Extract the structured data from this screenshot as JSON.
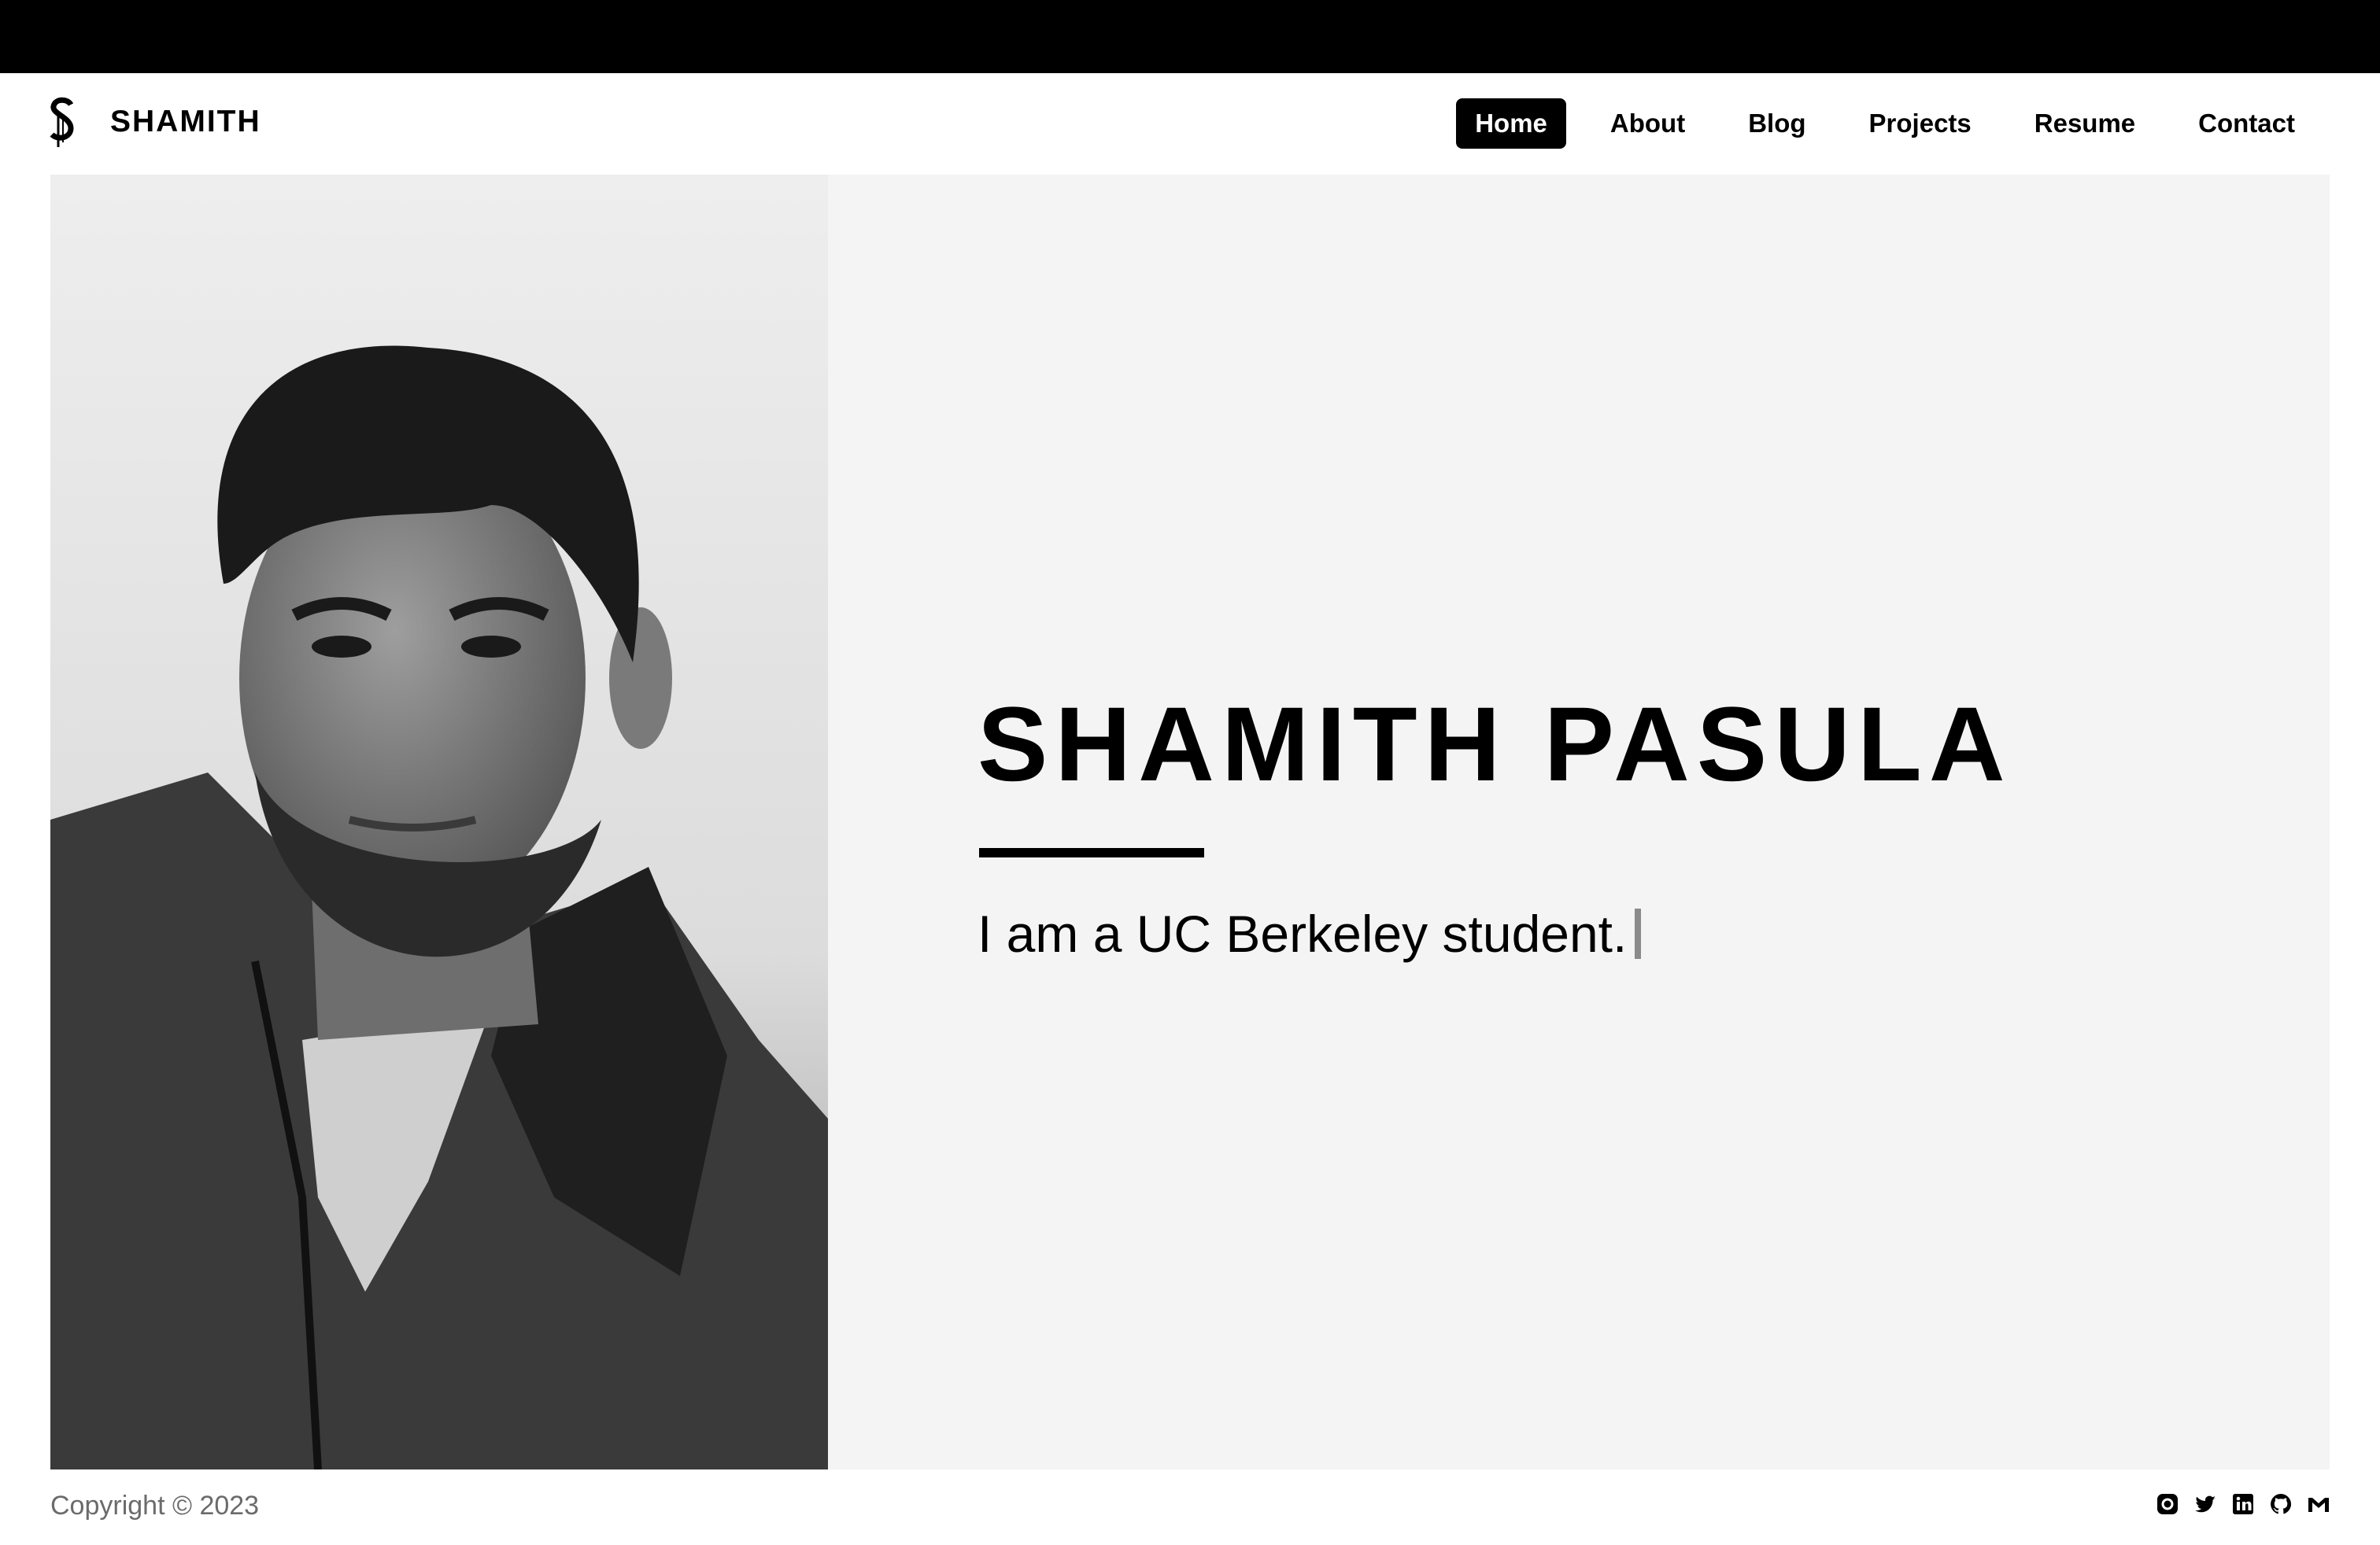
{
  "brand": {
    "name": "SHAMITH",
    "logo_icon": "s-monogram-icon"
  },
  "nav": {
    "items": [
      {
        "label": "Home",
        "active": true
      },
      {
        "label": "About",
        "active": false
      },
      {
        "label": "Blog",
        "active": false
      },
      {
        "label": "Projects",
        "active": false
      },
      {
        "label": "Resume",
        "active": false
      },
      {
        "label": "Contact",
        "active": false
      }
    ]
  },
  "hero": {
    "name": "SHAMITH PASULA",
    "tagline": "I am a UC Berkeley student."
  },
  "footer": {
    "copyright": "Copyright © 2023",
    "social_icons": [
      "instagram-icon",
      "twitter-icon",
      "linkedin-icon",
      "github-icon",
      "gmail-icon"
    ]
  },
  "colors": {
    "accent": "#000000",
    "panel": "#f4f4f4",
    "muted_text": "#6b6b6b"
  }
}
